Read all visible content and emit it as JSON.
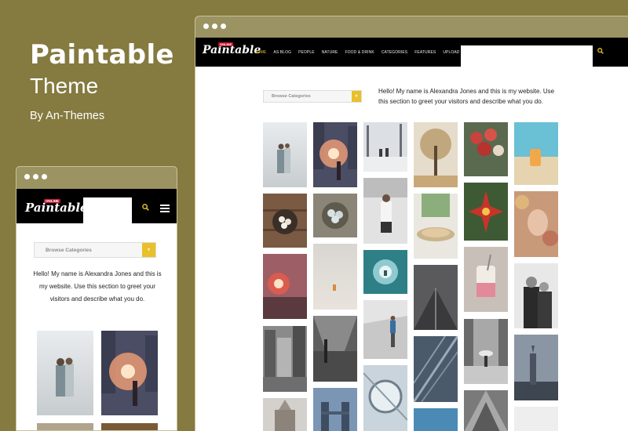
{
  "promo": {
    "title": "Paintable",
    "subtitle": "Theme",
    "author": "By An-Themes"
  },
  "brand": {
    "logo_text": "Paintable",
    "logo_tag": "ONLINE",
    "accent": "#e9c02a",
    "background": "#857a3f"
  },
  "desktop": {
    "menu": [
      "HOME",
      "AS BLOG",
      "PEOPLE",
      "NATURE",
      "FOOD & DRINK",
      "CATEGORIES",
      "FEATURES",
      "UPLOAD"
    ],
    "active_menu": "HOME",
    "search_icon": "search-icon",
    "categories_label": "Browse Categories",
    "intro": "Hello! My name is Alexandra Jones and this is my website. Use this section to greet your visitors and describe what you do."
  },
  "mobile": {
    "search_icon": "search-icon",
    "menu_icon": "hamburger-menu-icon",
    "categories_label": "Browse Categories",
    "intro": "Hello! My name is Alexandra Jones and this is my website. Use this section to greet your visitors and describe what you do."
  }
}
